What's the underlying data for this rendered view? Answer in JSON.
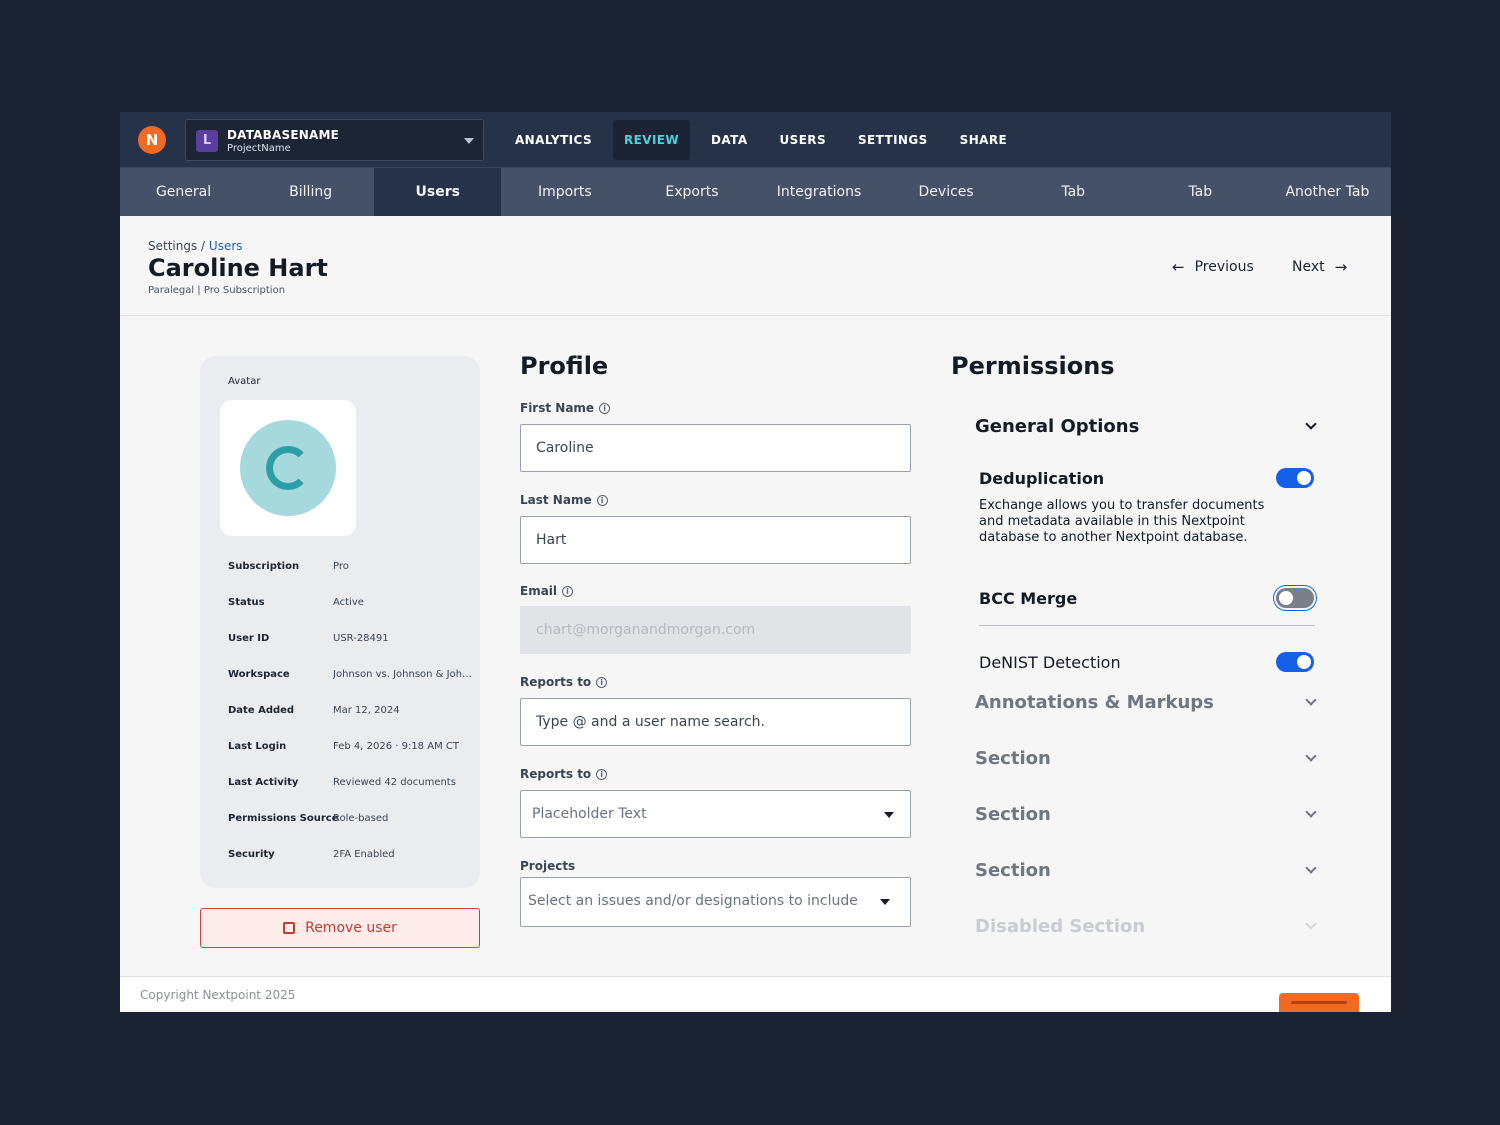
{
  "topbar": {
    "logo_glyph": "N",
    "database": {
      "badge": "L",
      "name": "DATABASENAME",
      "project": "ProjectName"
    },
    "nav": [
      "ANALYTICS",
      "REVIEW",
      "DATA",
      "USERS",
      "SETTINGS",
      "SHARE"
    ],
    "active_nav": "REVIEW"
  },
  "subtabs": {
    "items": [
      "General",
      "Billing",
      "Users",
      "Imports",
      "Exports",
      "Integrations",
      "Devices",
      "Tab",
      "Tab",
      "Another Tab"
    ],
    "active": "Users"
  },
  "header": {
    "breadcrumb_root": "Settings",
    "breadcrumb_sep": "/",
    "breadcrumb_current": "Users",
    "title": "Caroline Hart",
    "subtitle": "Paralegal | Pro Subscription",
    "previous_label": "Previous",
    "next_label": "Next"
  },
  "user_card": {
    "avatar_label": "Avatar",
    "avatar_color": "#a5d9dc",
    "meta": [
      {
        "key": "Subscription",
        "value": "Pro"
      },
      {
        "key": "Status",
        "value": "Active"
      },
      {
        "key": "User ID",
        "value": "USR-28491"
      },
      {
        "key": "Workspace",
        "value": "Johnson vs. Johnson & Johnson"
      },
      {
        "key": "Date Added",
        "value": "Mar 12, 2024"
      },
      {
        "key": "Last Login",
        "value": "Feb 4, 2026 · 9:18 AM CT"
      },
      {
        "key": "Last Activity",
        "value": "Reviewed 42 documents"
      },
      {
        "key": "Permissions Source",
        "value": "Role-based"
      },
      {
        "key": "Security",
        "value": "2FA Enabled"
      }
    ],
    "remove_label": "Remove user"
  },
  "profile": {
    "title": "Profile",
    "first_name": {
      "label": "First Name",
      "value": "Caroline"
    },
    "last_name": {
      "label": "Last Name",
      "value": "Hart"
    },
    "email": {
      "label": "Email",
      "value": "chart@morganandmorgan.com"
    },
    "reports_to_1": {
      "label": "Reports to",
      "placeholder": "Type @ and a user name search."
    },
    "reports_to_2": {
      "label": "Reports to",
      "placeholder": "Placeholder Text"
    },
    "projects": {
      "label": "Projects",
      "placeholder": "Select an issues and/or designations to include"
    }
  },
  "permissions": {
    "title": "Permissions",
    "general": {
      "title": "General Options",
      "options": [
        {
          "title": "Deduplication",
          "enabled": true,
          "description": "Exchange allows you to transfer documents and metadata available in this Nextpoint database to another Nextpoint database."
        },
        {
          "title": "BCC Merge",
          "enabled": false
        },
        {
          "title": "DeNIST Detection",
          "enabled": true
        }
      ]
    },
    "sections": [
      "Annotations & Markups",
      "Section",
      "Section",
      "Section",
      "Disabled Section"
    ]
  },
  "footer": {
    "copyright": "Copyright Nextpoint 2025"
  },
  "colors": {
    "accent": "#1560e8",
    "brand": "#f06a24",
    "danger": "#c83a33",
    "active_nav": "#4fd1db"
  }
}
